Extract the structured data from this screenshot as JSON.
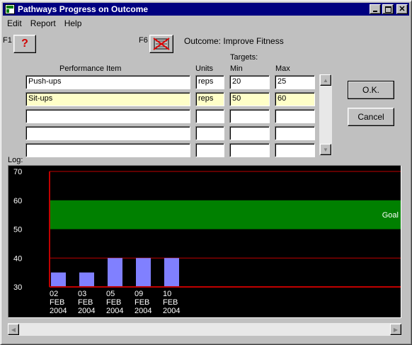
{
  "window": {
    "title": "Pathways Progress on Outcome"
  },
  "menu": [
    "Edit",
    "Report",
    "Help"
  ],
  "toolbar": {
    "f1_label": "F1",
    "help_icon": "?",
    "f6_label": "F6",
    "outcome": "Outcome: Improve Fitness"
  },
  "headers": {
    "performance_item": "Performance Item",
    "units": "Units",
    "targets": "Targets:",
    "min": "Min",
    "max": "Max"
  },
  "rows": [
    {
      "item": "Push-ups",
      "units": "reps",
      "min": "20",
      "max": "25",
      "highlighted": false
    },
    {
      "item": "Sit-ups",
      "units": "reps",
      "min": "50",
      "max": "60",
      "highlighted": true
    },
    {
      "item": "",
      "units": "",
      "min": "",
      "max": "",
      "highlighted": false
    },
    {
      "item": "",
      "units": "",
      "min": "",
      "max": "",
      "highlighted": false
    },
    {
      "item": "",
      "units": "",
      "min": "",
      "max": "",
      "highlighted": false
    }
  ],
  "buttons": {
    "ok": "O.K.",
    "cancel": "Cancel"
  },
  "log_label": "Log:",
  "colors": {
    "titlebar": "#000080",
    "goal_band": "#008000",
    "bars": "#8080ff",
    "axis": "#c00000",
    "highlight_field": "#ffffc8"
  },
  "chart_data": {
    "type": "bar",
    "categories": [
      "02 FEB 2004",
      "03 FEB 2004",
      "05 FEB 2004",
      "09 FEB 2004",
      "10 FEB 2004"
    ],
    "category_lines": [
      [
        "02",
        "FEB",
        "2004"
      ],
      [
        "03",
        "FEB",
        "2004"
      ],
      [
        "05",
        "FEB",
        "2004"
      ],
      [
        "09",
        "FEB",
        "2004"
      ],
      [
        "10",
        "FEB",
        "2004"
      ]
    ],
    "values": [
      35,
      35,
      40,
      40,
      40
    ],
    "ylim": [
      30,
      70
    ],
    "yticks": [
      30,
      40,
      50,
      60,
      70
    ],
    "goal_band": [
      50,
      60
    ],
    "goal_label": "Goal",
    "reference_lines": [
      40,
      70
    ],
    "grid": false,
    "background": "#000000"
  }
}
